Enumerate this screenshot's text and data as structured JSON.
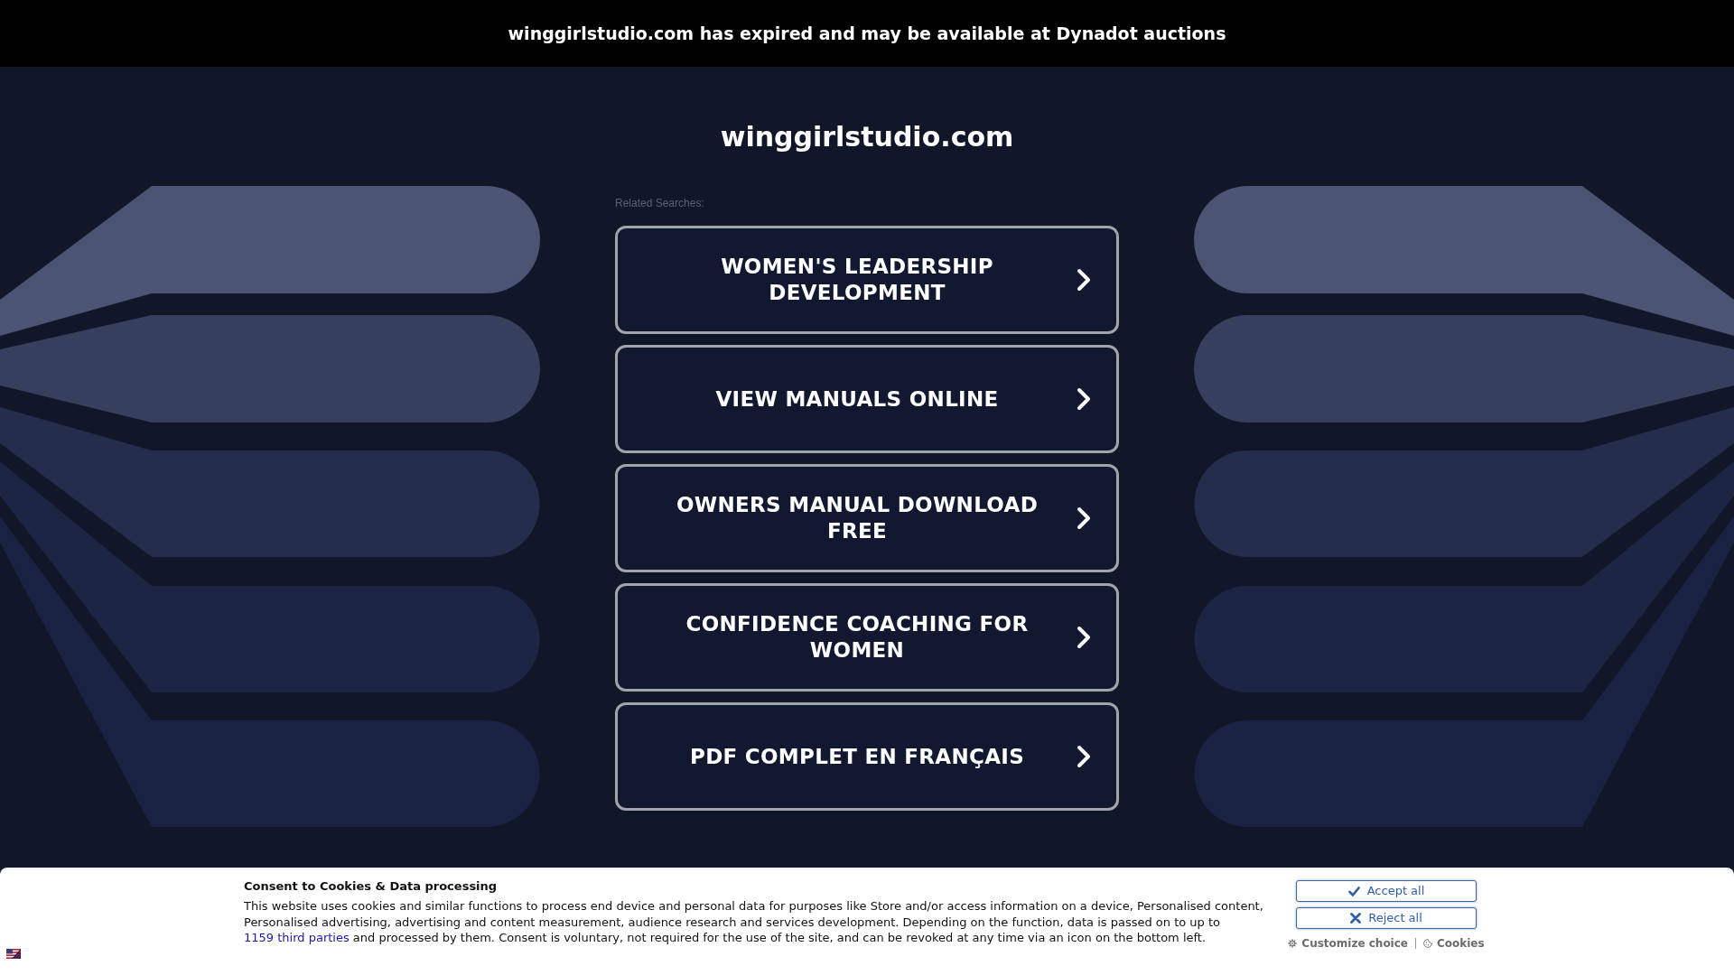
{
  "notice_bar": {
    "text": "winggirlstudio.com has expired and may be available at Dynadot auctions"
  },
  "domain_title": "winggirlstudio.com",
  "related_searches": {
    "label": "Related Searches:",
    "items": [
      "WOMEN'S LEADERSHIP DEVELOPMENT",
      "VIEW MANUALS ONLINE",
      "OWNERS MANUAL DOWNLOAD FREE",
      "CONFIDENCE COACHING FOR WOMEN",
      "PDF COMPLET EN FRANÇAIS"
    ]
  },
  "cookie_consent": {
    "title": "Consent to Cookies & Data processing",
    "text_before_link": "This website uses cookies and similar functions to process end device and personal data for purposes like Store and/or access information on a device, Personalised content, Personalised advertising, advertising and content measurement, audience research and services development. Depending on the function, data is passed on to up to",
    "link": "1159 third parties",
    "text_after_link": "and processed by them. Consent is voluntary, not required for the use of the site, and can be revoked at any time via an icon on the bottom left.",
    "buttons": [
      {
        "label": "Accept all",
        "kind": "accept"
      },
      {
        "label": "Reject all",
        "kind": "reject"
      }
    ],
    "links": [
      {
        "label": "Customize choice",
        "kind": "customize"
      },
      {
        "label": "Cookies",
        "kind": "cookies"
      }
    ]
  }
}
